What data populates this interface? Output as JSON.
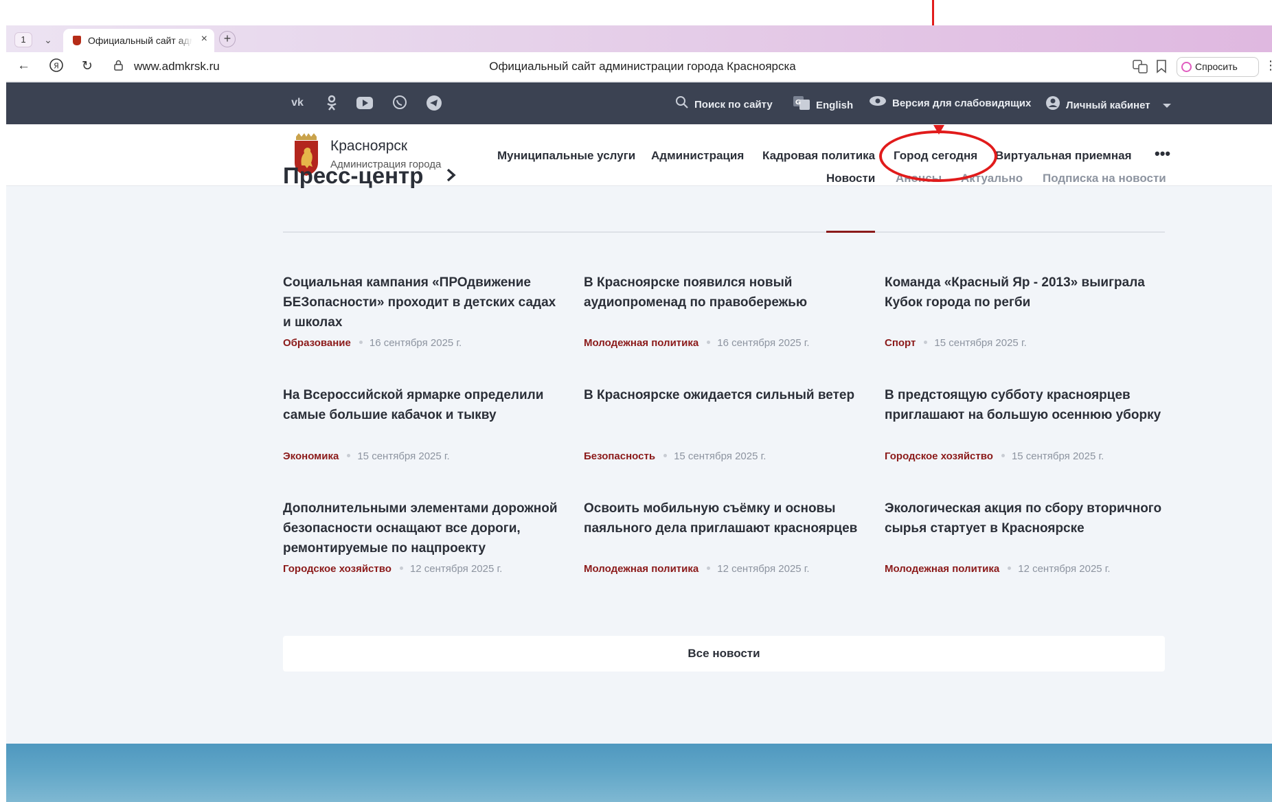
{
  "browser": {
    "tab_count": "1",
    "tab_title": "Официальный сайт администрации города Красноярска",
    "url": "www.admkrsk.ru",
    "page_title": "Официальный сайт администрации города Красноярска",
    "ask_label": "Спросить"
  },
  "topbar": {
    "social": [
      "vk-icon",
      "ok-icon",
      "youtube-icon",
      "viber-icon",
      "telegram-icon"
    ],
    "search_label": "Поиск по сайту",
    "english_label": "English",
    "accessibility_label": "Версия для слабовидящих",
    "cabinet_label": "Личный кабинет"
  },
  "site": {
    "brand_name": "Красноярск",
    "brand_sub": "Администрация города",
    "nav": [
      "Муниципальные услуги",
      "Администрация",
      "Кадровая политика",
      "Город сегодня",
      "Виртуальная приемная"
    ]
  },
  "press": {
    "title": "Пресс-центр",
    "tabs": [
      "Новости",
      "Анонсы",
      "Актуально",
      "Подписка на новости"
    ],
    "news": [
      {
        "title": "Социальная кампания «ПРОдвижение БЕЗопасности» проходит в детских садах и школах",
        "category": "Образование",
        "date": "16 сентября 2025 г."
      },
      {
        "title": "В Красноярске появился новый аудиопромена​д по правобережью",
        "category": "Молодежная политика",
        "date": "16 сентября 2025 г."
      },
      {
        "title": "Команда «Красный Яр - 2013» выиграла Кубок города по регби",
        "category": "Спорт",
        "date": "15 сентября 2025 г."
      },
      {
        "title": "На Всероссийской ярмарке определили самые большие кабачок и тыкву",
        "category": "Экономика",
        "date": "15 сентября 2025 г."
      },
      {
        "title": "В Красноярске ожидается сильный ветер",
        "category": "Безопасность",
        "date": "15 сентября 2025 г."
      },
      {
        "title": "В предстоящую субботу красноярцев приглашают на большую осеннюю уборку",
        "category": "Городское хозяйство",
        "date": "15 сентября 2025 г."
      },
      {
        "title": "Дополнительными элементами дорожной безопасности оснащают все дороги, ремонтируемые по нацпроекту",
        "category": "Городское хозяйство",
        "date": "12 сентября 2025 г."
      },
      {
        "title": "Освоить мобильную съёмку и основы паяльного дела приглашают красноярцев",
        "category": "Молодежная политика",
        "date": "12 сентября 2025 г."
      },
      {
        "title": "Экологическая акция по сбору вторичного сырья стартует в Красноярске",
        "category": "Молодежная политика",
        "date": "12 сентября 2025 г."
      }
    ],
    "all_news_label": "Все новости"
  },
  "colors": {
    "topbar_bg": "#3b4252",
    "accent": "#8b1a1a",
    "annotation": "#e11b1b"
  }
}
